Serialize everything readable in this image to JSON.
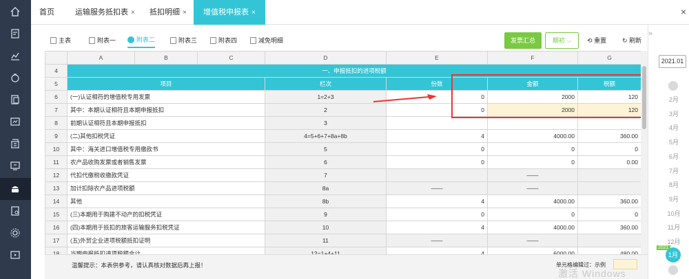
{
  "tabs": [
    {
      "label": "首页",
      "closable": false
    },
    {
      "label": "运输服务抵扣表",
      "closable": true
    },
    {
      "label": "抵扣明细",
      "closable": true
    },
    {
      "label": "增值税申报表",
      "closable": true,
      "active": true
    }
  ],
  "close_glyph": "×",
  "subtabs": [
    "主表",
    "附表一",
    "附表二",
    "附表三",
    "附表四",
    "减免明细"
  ],
  "active_subtab": "附表二",
  "toolbar": {
    "invoice_summary": "发票汇总",
    "period": "期初",
    "reset": "重置",
    "refresh": "刷新"
  },
  "sheet": {
    "column_letters": [
      "A",
      "B",
      "C",
      "D",
      "E",
      "F",
      "G"
    ],
    "section_title": "一、申报抵扣的进项税额",
    "headers": {
      "item": "项目",
      "col_no": "栏次",
      "count": "份数",
      "amount": "金额",
      "tax": "税额"
    },
    "rows": [
      {
        "rn": "6",
        "item": "(一)认证相符的增值税专用发票",
        "col": "1=2+3",
        "count": "0",
        "amount": "2000",
        "tax": "120"
      },
      {
        "rn": "7",
        "item": "其中：本期认证相符且本期申报抵扣",
        "col": "2",
        "count": "0",
        "amount": "2000",
        "tax": "120"
      },
      {
        "rn": "8",
        "item": "前期认证相符且本期申报抵扣",
        "col": "3",
        "count": "",
        "amount": "",
        "tax": ""
      },
      {
        "rn": "9",
        "item": "(二)其他扣税凭证",
        "col": "4=5+6+7+8a+8b",
        "count": "4",
        "amount": "4000.00",
        "tax": "360.00"
      },
      {
        "rn": "10",
        "item": "其中：海关进口增值税专用缴款书",
        "col": "5",
        "count": "0",
        "amount": "0",
        "tax": "0"
      },
      {
        "rn": "11",
        "item": "农产品收购发票或者销售发票",
        "col": "6",
        "count": "0",
        "amount": "0",
        "tax": "0.00"
      },
      {
        "rn": "12",
        "item": "代扣代缴税收缴款凭证",
        "col": "7",
        "count": "",
        "amount": "——",
        "tax": ""
      },
      {
        "rn": "13",
        "item": "加计扣除农产品进项税额",
        "col": "8a",
        "count": "——",
        "amount": "——",
        "tax": ""
      },
      {
        "rn": "14",
        "item": "其他",
        "col": "8b",
        "count": "4",
        "amount": "4000.00",
        "tax": "360.00"
      },
      {
        "rn": "15",
        "item": "(三)本期用于购建不动产的扣税凭证",
        "col": "9",
        "count": "0",
        "amount": "0",
        "tax": "0"
      },
      {
        "rn": "16",
        "item": "(四)本期用于抵扣的旅客运输服务扣税凭证",
        "col": "10",
        "count": "4",
        "amount": "4000.00",
        "tax": "360.00"
      },
      {
        "rn": "17",
        "item": "(五)外贸企业进项税额抵扣证明",
        "col": "11",
        "count": "——",
        "amount": "——",
        "tax": ""
      },
      {
        "rn": "18",
        "item": "当期申报抵扣进项税额合计",
        "col": "12=1+4+11",
        "count": "4",
        "amount": "6000.00",
        "tax": "480.00"
      }
    ]
  },
  "footer": {
    "hint": "温馨提示：本表供参考，请认真核对数据后再上报！",
    "legend_label": "单元格编辑过：示例"
  },
  "months": {
    "year": "2021.01",
    "list": [
      "2月",
      "3月",
      "4月",
      "5月",
      "6月",
      "7月",
      "8月",
      "9月",
      "10月",
      "11月",
      "12月"
    ],
    "active": "1月",
    "badge": "2021"
  },
  "watermark": "激活 Windows",
  "colors": {
    "accent": "#33c5d6",
    "green": "#7ac943",
    "highlight": "#fdf3d6",
    "annotation": "#e8362f",
    "rail": "#2f3a4c"
  },
  "rail_icons": [
    "home-icon",
    "document-edit-icon",
    "chart-icon",
    "money-bag-icon",
    "invoice-icon",
    "ledger-icon",
    "building-icon",
    "screen-icon",
    "tax-declaration-icon",
    "report-icon",
    "settings-icon",
    "play-icon"
  ]
}
